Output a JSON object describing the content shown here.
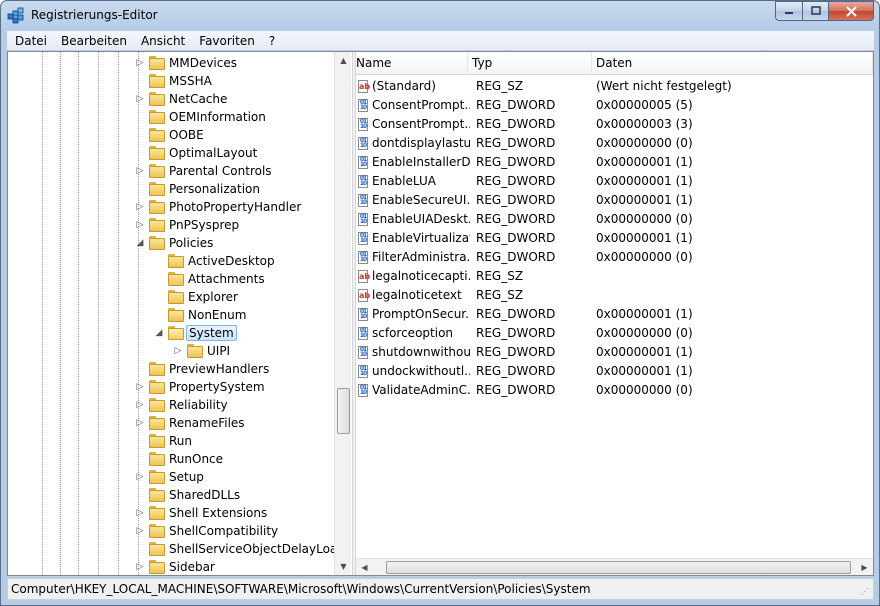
{
  "window": {
    "title": "Registrierungs-Editor"
  },
  "menu": [
    {
      "label": "Datei"
    },
    {
      "label": "Bearbeiten"
    },
    {
      "label": "Ansicht"
    },
    {
      "label": "Favoriten"
    },
    {
      "label": "?"
    }
  ],
  "tree": {
    "items": [
      {
        "label": "MMDevices",
        "level": 0,
        "expander": "collapsed"
      },
      {
        "label": "MSSHA",
        "level": 0,
        "expander": "none"
      },
      {
        "label": "NetCache",
        "level": 0,
        "expander": "collapsed"
      },
      {
        "label": "OEMInformation",
        "level": 0,
        "expander": "none"
      },
      {
        "label": "OOBE",
        "level": 0,
        "expander": "none"
      },
      {
        "label": "OptimalLayout",
        "level": 0,
        "expander": "none"
      },
      {
        "label": "Parental Controls",
        "level": 0,
        "expander": "collapsed"
      },
      {
        "label": "Personalization",
        "level": 0,
        "expander": "none"
      },
      {
        "label": "PhotoPropertyHandler",
        "level": 0,
        "expander": "collapsed"
      },
      {
        "label": "PnPSysprep",
        "level": 0,
        "expander": "collapsed"
      },
      {
        "label": "Policies",
        "level": 0,
        "expander": "expanded"
      },
      {
        "label": "ActiveDesktop",
        "level": 1,
        "expander": "none"
      },
      {
        "label": "Attachments",
        "level": 1,
        "expander": "none"
      },
      {
        "label": "Explorer",
        "level": 1,
        "expander": "none"
      },
      {
        "label": "NonEnum",
        "level": 1,
        "expander": "none"
      },
      {
        "label": "System",
        "level": 1,
        "expander": "expanded",
        "selected": true
      },
      {
        "label": "UIPI",
        "level": 2,
        "expander": "collapsed"
      },
      {
        "label": "PreviewHandlers",
        "level": 0,
        "expander": "none"
      },
      {
        "label": "PropertySystem",
        "level": 0,
        "expander": "collapsed"
      },
      {
        "label": "Reliability",
        "level": 0,
        "expander": "collapsed"
      },
      {
        "label": "RenameFiles",
        "level": 0,
        "expander": "collapsed"
      },
      {
        "label": "Run",
        "level": 0,
        "expander": "none"
      },
      {
        "label": "RunOnce",
        "level": 0,
        "expander": "none"
      },
      {
        "label": "Setup",
        "level": 0,
        "expander": "collapsed"
      },
      {
        "label": "SharedDLLs",
        "level": 0,
        "expander": "none"
      },
      {
        "label": "Shell Extensions",
        "level": 0,
        "expander": "collapsed"
      },
      {
        "label": "ShellCompatibility",
        "level": 0,
        "expander": "collapsed"
      },
      {
        "label": "ShellServiceObjectDelayLoad",
        "level": 0,
        "expander": "none"
      },
      {
        "label": "Sidebar",
        "level": 0,
        "expander": "collapsed"
      }
    ]
  },
  "list": {
    "columns": [
      "Name",
      "Typ",
      "Daten"
    ],
    "rows": [
      {
        "name": "(Standard)",
        "type": "REG_SZ",
        "data": "(Wert nicht festgelegt)",
        "icon": "string-value-icon"
      },
      {
        "name": "ConsentPrompt...",
        "type": "REG_DWORD",
        "data": "0x00000005 (5)",
        "icon": "dword-value-icon"
      },
      {
        "name": "ConsentPrompt...",
        "type": "REG_DWORD",
        "data": "0x00000003 (3)",
        "icon": "dword-value-icon"
      },
      {
        "name": "dontdisplaylastu...",
        "type": "REG_DWORD",
        "data": "0x00000000 (0)",
        "icon": "dword-value-icon"
      },
      {
        "name": "EnableInstallerD...",
        "type": "REG_DWORD",
        "data": "0x00000001 (1)",
        "icon": "dword-value-icon"
      },
      {
        "name": "EnableLUA",
        "type": "REG_DWORD",
        "data": "0x00000001 (1)",
        "icon": "dword-value-icon"
      },
      {
        "name": "EnableSecureUI...",
        "type": "REG_DWORD",
        "data": "0x00000001 (1)",
        "icon": "dword-value-icon"
      },
      {
        "name": "EnableUIADeskt...",
        "type": "REG_DWORD",
        "data": "0x00000000 (0)",
        "icon": "dword-value-icon"
      },
      {
        "name": "EnableVirtualizat...",
        "type": "REG_DWORD",
        "data": "0x00000001 (1)",
        "icon": "dword-value-icon"
      },
      {
        "name": "FilterAdministra...",
        "type": "REG_DWORD",
        "data": "0x00000000 (0)",
        "icon": "dword-value-icon"
      },
      {
        "name": "legalnoticecapti...",
        "type": "REG_SZ",
        "data": "",
        "icon": "string-value-icon"
      },
      {
        "name": "legalnoticetext",
        "type": "REG_SZ",
        "data": "",
        "icon": "string-value-icon"
      },
      {
        "name": "PromptOnSecur...",
        "type": "REG_DWORD",
        "data": "0x00000001 (1)",
        "icon": "dword-value-icon"
      },
      {
        "name": "scforceoption",
        "type": "REG_DWORD",
        "data": "0x00000000 (0)",
        "icon": "dword-value-icon"
      },
      {
        "name": "shutdownwithou...",
        "type": "REG_DWORD",
        "data": "0x00000001 (1)",
        "icon": "dword-value-icon"
      },
      {
        "name": "undockwithoutl...",
        "type": "REG_DWORD",
        "data": "0x00000001 (1)",
        "icon": "dword-value-icon"
      },
      {
        "name": "ValidateAdminC...",
        "type": "REG_DWORD",
        "data": "0x00000000 (0)",
        "icon": "dword-value-icon"
      }
    ]
  },
  "status": {
    "path": "Computer\\HKEY_LOCAL_MACHINE\\SOFTWARE\\Microsoft\\Windows\\CurrentVersion\\Policies\\System"
  }
}
